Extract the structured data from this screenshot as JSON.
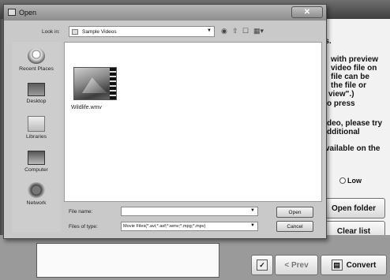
{
  "background": {
    "right_panel_lines": [
      "ies.",
      "with preview",
      "video file on",
      "file can be",
      "the file or",
      "view\".)",
      "o press",
      "deo, please try",
      "dditional",
      "vailable on the"
    ],
    "radio_low_label": "Low",
    "open_folder_label": "Open folder",
    "clear_list_label": "Clear list",
    "prev_label": "< Prev",
    "convert_label": "Convert"
  },
  "dialog": {
    "title": "Open",
    "look_in_label": "Look in:",
    "look_in_value": "Sample Videos",
    "places": [
      "Recent Places",
      "Desktop",
      "Libraries",
      "Computer",
      "Network"
    ],
    "files": [
      {
        "name": "Wildlife.wmv"
      }
    ],
    "file_name_label": "File name:",
    "file_name_value": "",
    "files_of_type_label": "Files of type:",
    "files_of_type_value": "Movie Files(*.avi;*.asf;*.wmv;*.mpg;*.mpv)",
    "open_label": "Open",
    "cancel_label": "Cancel"
  }
}
